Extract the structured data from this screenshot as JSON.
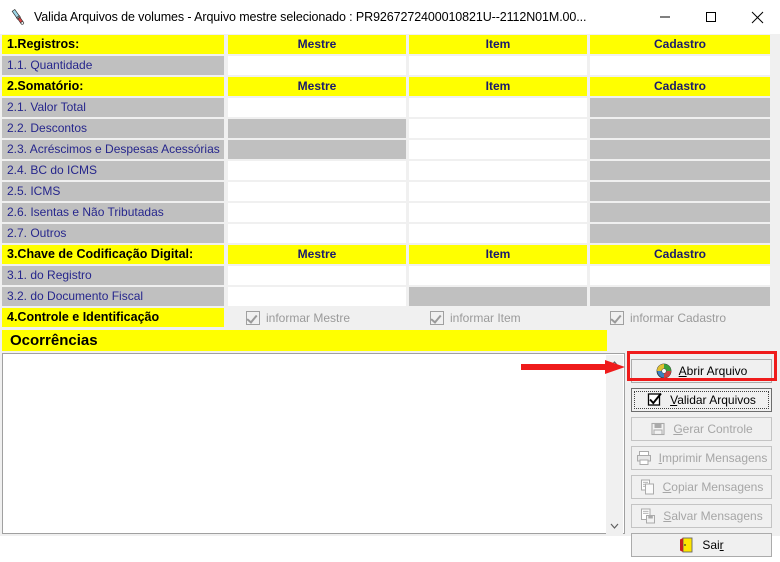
{
  "window": {
    "title": "Valida Arquivos de volumes - Arquivo mestre selecionado : PR9267272400010821U--2112N01M.00...",
    "icon": "magnifier-document-icon",
    "minimize_label": "—",
    "maximize_label": "☐",
    "close_label": "✕"
  },
  "grid": {
    "columns": [
      "Mestre",
      "Item",
      "Cadastro"
    ],
    "sections": [
      {
        "header": "1.Registros:",
        "rows": [
          {
            "label": "1.1. Quantidade",
            "mestre": "",
            "item": "",
            "cadastro": "",
            "mestre_state": "white",
            "item_state": "white",
            "cadastro_state": "white"
          }
        ]
      },
      {
        "header": "2.Somatório:",
        "rows": [
          {
            "label": "2.1. Valor Total",
            "mestre": "",
            "item": "",
            "cadastro": "",
            "mestre_state": "white",
            "item_state": "white",
            "cadastro_state": "gray"
          },
          {
            "label": "2.2. Descontos",
            "mestre": "",
            "item": "",
            "cadastro": "",
            "mestre_state": "gray",
            "item_state": "white",
            "cadastro_state": "gray"
          },
          {
            "label": "2.3. Acréscimos e Despesas Acessórias",
            "mestre": "",
            "item": "",
            "cadastro": "",
            "mestre_state": "gray",
            "item_state": "white",
            "cadastro_state": "gray"
          },
          {
            "label": "2.4. BC do ICMS",
            "mestre": "",
            "item": "",
            "cadastro": "",
            "mestre_state": "white",
            "item_state": "white",
            "cadastro_state": "gray"
          },
          {
            "label": "2.5. ICMS",
            "mestre": "",
            "item": "",
            "cadastro": "",
            "mestre_state": "white",
            "item_state": "white",
            "cadastro_state": "gray"
          },
          {
            "label": "2.6. Isentas e Não Tributadas",
            "mestre": "",
            "item": "",
            "cadastro": "",
            "mestre_state": "white",
            "item_state": "white",
            "cadastro_state": "gray"
          },
          {
            "label": "2.7. Outros",
            "mestre": "",
            "item": "",
            "cadastro": "",
            "mestre_state": "white",
            "item_state": "white",
            "cadastro_state": "gray"
          }
        ]
      },
      {
        "header": "3.Chave de Codificação Digital:",
        "rows": [
          {
            "label": "3.1. do Registro",
            "mestre": "",
            "item": "",
            "cadastro": "",
            "mestre_state": "white",
            "item_state": "white",
            "cadastro_state": "white"
          },
          {
            "label": "3.2. do Documento Fiscal",
            "mestre": "",
            "item": "",
            "cadastro": "",
            "mestre_state": "white",
            "item_state": "gray",
            "cadastro_state": "gray"
          }
        ]
      }
    ]
  },
  "controle": {
    "label": "4.Controle e Identificação",
    "checkboxes": [
      {
        "label": "informar Mestre",
        "checked": true,
        "enabled": false
      },
      {
        "label": "informar Item",
        "checked": true,
        "enabled": false
      },
      {
        "label": "informar Cadastro",
        "checked": true,
        "enabled": false
      }
    ]
  },
  "occurrences": {
    "header": "Ocorrências",
    "text": ""
  },
  "buttons": [
    {
      "label": "Abrir Arquivo",
      "accel": "A",
      "icon": "cd-disc-icon",
      "enabled": true,
      "focused": false
    },
    {
      "label": "Validar Arquivos",
      "accel": "V",
      "icon": "checkbox-checked-icon",
      "enabled": true,
      "focused": true
    },
    {
      "label": "Gerar Controle",
      "accel": "G",
      "icon": "floppy-disk-icon",
      "enabled": false,
      "focused": false
    },
    {
      "label": "Imprimir Mensagens",
      "accel": "I",
      "icon": "printer-icon",
      "enabled": false,
      "focused": false
    },
    {
      "label": "Copiar Mensagens",
      "accel": "C",
      "icon": "copy-icon",
      "enabled": false,
      "focused": false
    },
    {
      "label": "Salvar Mensagens",
      "accel": "S",
      "icon": "save-disk-icon",
      "enabled": false,
      "focused": false
    },
    {
      "label": "Sair",
      "accel": "r",
      "icon": "exit-door-icon",
      "enabled": true,
      "focused": false
    }
  ],
  "annotation": {
    "highlight_color": "#ef1b1b",
    "target": "Validar Arquivos"
  },
  "colors": {
    "header_yellow": "#ffff00",
    "label_gray": "#c0c0c0",
    "label_text_blue": "#26268c",
    "window_bg": "#f0f0f0",
    "cell_white": "#ffffff"
  }
}
